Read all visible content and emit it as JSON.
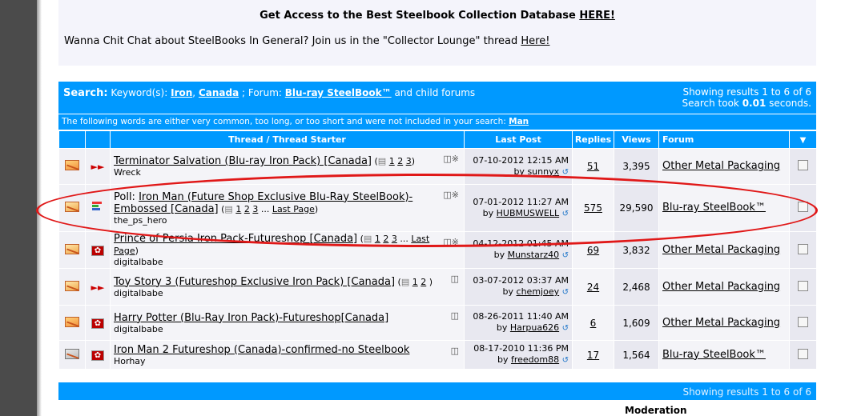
{
  "notice": {
    "line1_text": "Get Access to the Best Steelbook Collection Database ",
    "line1_link": "HERE!",
    "line2_text": "Wanna Chit Chat about SteelBooks In General? Join us in the \"Collector Lounge\" thread ",
    "line2_link": "Here!"
  },
  "search": {
    "label": "Search:",
    "keywords_label": "Keyword(s):",
    "kw1": "Iron",
    "sep": ",",
    "kw2": "Canada",
    "forum_label": "; Forum:",
    "forum": "Blu-ray SteelBook™",
    "child": "and child forums",
    "results_line1": "Showing results 1 to 6 of 6",
    "results_line2_a": "Search took ",
    "results_time": "0.01",
    "results_line2_b": " seconds."
  },
  "words_notice": {
    "text": "The following words are either very common, too long, or too short and were not included in your search: ",
    "word": "Man"
  },
  "columns": {
    "thread": "Thread / Thread Starter",
    "last_post": "Last Post",
    "replies": "Replies",
    "views": "Views",
    "forum": "Forum"
  },
  "threads": [
    {
      "prefix": "",
      "title": "Terminator Salvation (Blu-ray Iron Pack) [Canada]",
      "pages_open": " (",
      "p1": "1",
      "p2": "2",
      "p3": "3",
      "pages_more": "",
      "last_page": "",
      "pages_close": ")",
      "starter": "Wreck",
      "date": "07-10-2012",
      "time": "12:15 AM",
      "by": "by ",
      "user": "sunnyx",
      "replies": "51",
      "views": "3,395",
      "forum": "Other Metal Packaging",
      "icon": "arrow"
    },
    {
      "prefix": "Poll: ",
      "title": "Iron Man (Future Shop Exclusive Blu-Ray SteelBook)-Embossed [Canada]",
      "pages_open": " (",
      "p1": "1",
      "p2": "2",
      "p3": "3",
      "pages_more": " ... ",
      "last_page": "Last Page",
      "pages_close": ")",
      "starter": "the_ps_hero",
      "date": "07-01-2012",
      "time": "11:27 AM",
      "by": "by ",
      "user": "HUBMUSWELL",
      "replies": "575",
      "views": "29,590",
      "forum": "Blu-ray SteelBook™",
      "icon": "poll"
    },
    {
      "prefix": "",
      "title": "Prince of Persia Iron Pack-Futureshop [Canada]",
      "pages_open": " (",
      "p1": "1",
      "p2": "2",
      "p3": "3",
      "pages_more": " ... ",
      "last_page": "Last Page",
      "pages_close": ")",
      "starter": "digitalbabe",
      "date": "04-12-2012",
      "time": "01:45 AM",
      "by": "by ",
      "user": "Munstarz40",
      "replies": "69",
      "views": "3,832",
      "forum": "Other Metal Packaging",
      "icon": "canada"
    },
    {
      "prefix": "",
      "title": "Toy Story 3 (Futureshop Exclusive Iron Pack) [Canada]",
      "pages_open": " (",
      "p1": "1",
      "p2": "2",
      "p3": "",
      "pages_more": "",
      "last_page": "",
      "pages_close": ")",
      "starter": "digitalbabe",
      "date": "03-07-2012",
      "time": "03:37 AM",
      "by": "by ",
      "user": "chemjoey",
      "replies": "24",
      "views": "2,468",
      "forum": "Other Metal Packaging",
      "icon": "arrow"
    },
    {
      "prefix": "",
      "title": "Harry Potter (Blu-Ray Iron Pack)-Futureshop[Canada]",
      "pages_open": "",
      "p1": "",
      "p2": "",
      "p3": "",
      "pages_more": "",
      "last_page": "",
      "pages_close": "",
      "starter": "digitalbabe",
      "date": "08-26-2011",
      "time": "11:40 AM",
      "by": "by ",
      "user": "Harpua626",
      "replies": "6",
      "views": "1,609",
      "forum": "Other Metal Packaging",
      "icon": "canada"
    },
    {
      "prefix": "",
      "title": "Iron Man 2 Futureshop (Canada)-confirmed-no Steelbook",
      "pages_open": "",
      "p1": "",
      "p2": "",
      "p3": "",
      "pages_more": "",
      "last_page": "",
      "pages_close": "",
      "starter": "Horhay",
      "date": "08-17-2010",
      "time": "11:36 PM",
      "by": "by ",
      "user": "freedom88",
      "replies": "17",
      "views": "1,564",
      "forum": "Blu-ray SteelBook™",
      "icon": "canada"
    }
  ],
  "footer": {
    "results": "Showing results 1 to 6 of 6"
  },
  "moderation": "Moderation",
  "colors": {
    "header_blue": "#0099ff",
    "annotation_red": "#e01818"
  }
}
